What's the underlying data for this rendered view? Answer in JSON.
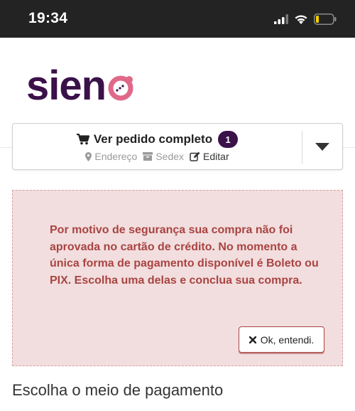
{
  "status_bar": {
    "time": "19:34",
    "icons": [
      "signal-icon",
      "wifi-icon",
      "battery-icon"
    ],
    "battery_level": 0.15
  },
  "logo": {
    "text": "sien"
  },
  "order": {
    "title": "Ver pedido completo",
    "count": "1",
    "steps": [
      {
        "label": "Endereço",
        "icon": "map-marker-icon"
      },
      {
        "label": "Sedex",
        "icon": "box-icon"
      },
      {
        "label": "Editar",
        "icon": "edit-icon"
      }
    ]
  },
  "alert": {
    "message": "Por motivo de segurança sua compra não foi aprovada no cartão de crédito. No momento a única forma de pagamento disponível é Boleto ou PIX. Escolha uma delas e conclua sua compra.",
    "button_label": "Ok, entendi."
  },
  "payment": {
    "section_title": "Escolha o meio de pagamento"
  },
  "colors": {
    "brand": "#3b1149",
    "accent": "#e0698a",
    "alert_bg": "#f2dede",
    "alert_text": "#a94442",
    "battery": "#f5d000"
  }
}
